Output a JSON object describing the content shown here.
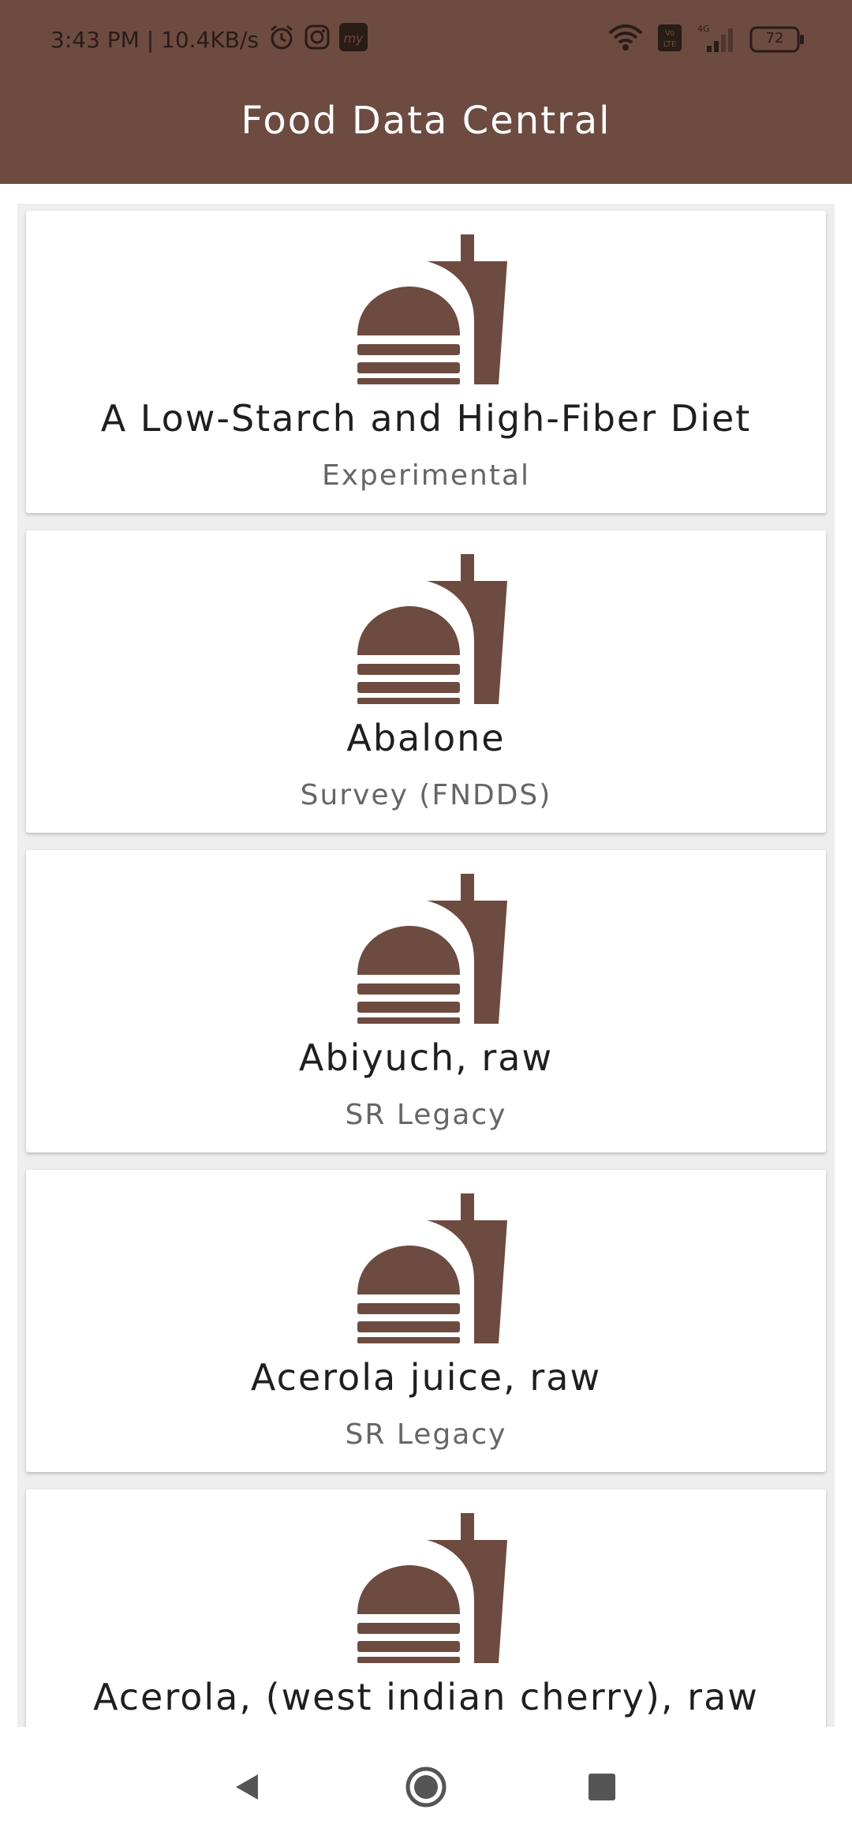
{
  "status_bar": {
    "time_speed": "3:43 PM | 10.4KB/s",
    "network_label": "4G",
    "battery": "72"
  },
  "app": {
    "title": "Food Data Central"
  },
  "colors": {
    "primary": "#6d4b40",
    "card_background": "#ffffff",
    "list_background": "#eeeeee"
  },
  "foods": [
    {
      "name": "A Low-Starch and High-Fiber Diet",
      "type": "Experimental",
      "icon": "fastfood-icon"
    },
    {
      "name": "Abalone",
      "type": "Survey (FNDDS)",
      "icon": "fastfood-icon"
    },
    {
      "name": "Abiyuch, raw",
      "type": "SR Legacy",
      "icon": "fastfood-icon"
    },
    {
      "name": "Acerola juice, raw",
      "type": "SR Legacy",
      "icon": "fastfood-icon"
    },
    {
      "name": "Acerola, (west indian cherry), raw",
      "type": "",
      "icon": "fastfood-icon"
    }
  ],
  "nav": {
    "back": "back-icon",
    "home": "home-icon",
    "recents": "recents-icon"
  }
}
